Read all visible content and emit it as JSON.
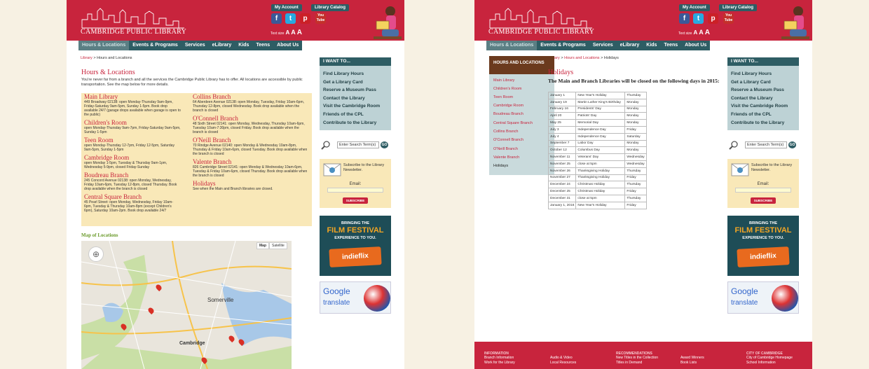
{
  "header": {
    "library_name": "CAMBRIDGE PUBLIC LIBRARY",
    "my_account": "My Account",
    "library_catalog": "Library Catalog",
    "text_size_label": "Text size",
    "text_size_a1": "A",
    "text_size_a2": "A",
    "text_size_a3": "A",
    "social": [
      "f",
      "t",
      "p",
      "You Tube"
    ]
  },
  "nav": [
    "Hours & Locations",
    "Events & Programs",
    "Services",
    "eLibrary",
    "Kids",
    "Teens",
    "About Us"
  ],
  "sidebar": {
    "title": "I WANT TO...",
    "items": [
      "Find Library Hours",
      "Get a Library Card",
      "Reserve a Museum Pass",
      "Contact the Library",
      "Visit the Cambridge Room",
      "Friends of the CPL",
      "Contribute to the Library"
    ],
    "search_placeholder": "Enter Search Term(s)",
    "go": "GO",
    "newsletter_text": "Subscribe to the Library Newsletter.",
    "email_label": "Email:",
    "subscribe": "SUBSCRIBE",
    "film_line1": "BRINGING THE",
    "film_line2": "FILM FESTIVAL",
    "film_line3": "EXPERIENCE TO YOU.",
    "film_brand": "indieflix",
    "google": "Google",
    "translate": "translate"
  },
  "pageA": {
    "crumb_home": "Library",
    "crumb_sep": ">",
    "crumb_current": "Hours and Locations",
    "title": "Hours & Locations",
    "intro": "You're never far from a branch and all the services the Cambridge Public Library has to offer. All locations are accessible by public transportation. See the map below for more details.",
    "left_branches": [
      {
        "name": "Main Library",
        "text": "449 Broadway 02138: open Monday-Thursday 9am-9pm, Friday-Saturday 9am-5pm, Sunday 1-5pm. Book drop available 24/7 (garage drops available when garage is open to the public)"
      },
      {
        "name": "Children's Room",
        "text": "open Monday-Thursday 9am-7pm, Friday-Saturday 9am-5pm, Sunday 1-5pm"
      },
      {
        "name": "Teen Room",
        "text": "open Monday-Thursday 12-7pm, Friday 12-5pm, Saturday 9am-5pm, Sunday 1-5pm"
      },
      {
        "name": "Cambridge Room",
        "text": "open Monday 1-5pm, Tuesday & Thursday 9am-1pm, Wednesday 5-9pm, closed Friday-Sunday"
      },
      {
        "name": "Boudreau Branch",
        "text": "245 Concord Avenue 02138: open Monday, Wednesday, Friday 10am-6pm, Tuesday 12-8pm, closed Thursday. Book drop available when the branch is closed"
      },
      {
        "name": "Central Square Branch",
        "text": "45 Pearl Street: open Monday, Wednesday, Friday 10am-6pm, Tuesday & Thursday 10am-8pm (except Children's 6pm), Saturday 10am-2pm. Book drop available 24/7"
      }
    ],
    "right_branches": [
      {
        "name": "Collins Branch",
        "text": "64 Aberdeen Avenue 02138: open Monday, Tuesday, Friday 10am-6pm, Thursday 12-8pm, closed Wednesday. Book drop available when the branch is closed"
      },
      {
        "name": "O'Connell Branch",
        "text": "48 Sixth Street 02141: open Monday, Wednesday, Thursday 10am-6pm, Tuesday 10am-7:30pm, closed Friday. Book drop available when the branch is closed"
      },
      {
        "name": "O'Neill Branch",
        "text": "70 Rindge Avenue 02140: open Monday & Wednesday 10am-8pm, Thursday & Friday 10am-6pm, closed Tuesday. Book drop available when the branch is closed"
      },
      {
        "name": "Valente Branch",
        "text": "826 Cambridge Street 02141: open Monday & Wednesday 10am-6pm, Tuesday & Friday 10am-6pm, closed Thursday. Book drop available when the branch is closed"
      },
      {
        "name": "Holidays",
        "text": "See when the Main and Branch libraries are closed."
      }
    ],
    "map_title": "Map of Locations",
    "map_btn": "Map",
    "sat_btn": "Satellite",
    "map_labels": [
      "Somerville",
      "Cambridge"
    ]
  },
  "pageB": {
    "crumb_home": "Library",
    "crumb_sep": ">",
    "crumb_mid": "Hours and Locations",
    "crumb_current": "Holidays",
    "menu_title": "HOURS AND LOCATIONS",
    "menu_items": [
      "Main Library",
      "Children's Room",
      "Teen Room",
      "Cambridge Room",
      "Boudreau Branch",
      "Central Square Branch",
      "Collins Branch",
      "O'Connell Branch",
      "O'Neill Branch",
      "Valente Branch",
      "Holidays"
    ],
    "title": "Holidays",
    "subtitle": "The Main and Branch Libraries will be closed on the following days in 2015:",
    "holidays": [
      [
        "January 1",
        "New Year's Holiday",
        "Thursday"
      ],
      [
        "January 19",
        "Martin Luther King's Birthday",
        "Monday"
      ],
      [
        "February 16",
        "Presidents' Day",
        "Monday"
      ],
      [
        "April 20",
        "Patriots' Day",
        "Monday"
      ],
      [
        "May 25",
        "Memorial Day",
        "Monday"
      ],
      [
        "July 3",
        "Independence Day",
        "Friday"
      ],
      [
        "July 4",
        "Independence Day",
        "Saturday"
      ],
      [
        "September 7",
        "Labor Day",
        "Monday"
      ],
      [
        "October 12",
        "Columbus Day",
        "Monday"
      ],
      [
        "November 11",
        "Veterans' Day",
        "Wednesday"
      ],
      [
        "November 25",
        "close at 5pm",
        "Wednesday"
      ],
      [
        "November 26",
        "Thanksgiving Holiday",
        "Thursday"
      ],
      [
        "November 27",
        "Thanksgiving Holiday",
        "Friday"
      ],
      [
        "December 24",
        "Christmas Holiday",
        "Thursday"
      ],
      [
        "December 25",
        "Christmas Holiday",
        "Friday"
      ],
      [
        "December 31",
        "close at 5pm",
        "Thursday"
      ],
      [
        "January 1, 2016",
        "New Year's Holiday",
        "Friday"
      ]
    ],
    "footer": [
      {
        "head": "INFORMATION",
        "items": [
          "Branch Information",
          "Work for the Library"
        ]
      },
      {
        "head": "",
        "items": [
          "Audio & Video",
          "Local Resources"
        ]
      },
      {
        "head": "RECOMMENDATIONS",
        "items": [
          "New Titles in the Collection",
          "Titles in Demand"
        ]
      },
      {
        "head": "",
        "items": [
          "Award Winners",
          "Book Lists"
        ]
      },
      {
        "head": "CITY OF CAMBRIDGE",
        "items": [
          "City of Cambridge Homepage",
          "School Information"
        ]
      }
    ]
  }
}
